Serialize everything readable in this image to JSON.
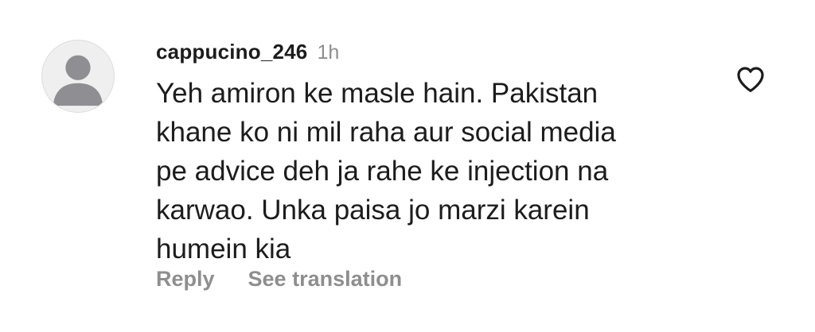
{
  "comment": {
    "username": "cappucino_246",
    "time": "1h",
    "text": "Yeh amiron ke masle hain. Pakistan\nkhane ko ni mil raha aur social media\npe advice deh ja rahe ke injection na\nkarwao. Unka paisa jo marzi karein\nhumein kia",
    "avatar_icon": "default-profile-icon",
    "like_icon": "heart-outline-icon",
    "actions": {
      "reply_label": "Reply",
      "translate_label": "See translation"
    }
  },
  "colors": {
    "primary_text": "#1c1c1c",
    "secondary_text": "#8e8e8e",
    "avatar_bg": "#efefef",
    "avatar_silhouette": "#8e8e93"
  }
}
